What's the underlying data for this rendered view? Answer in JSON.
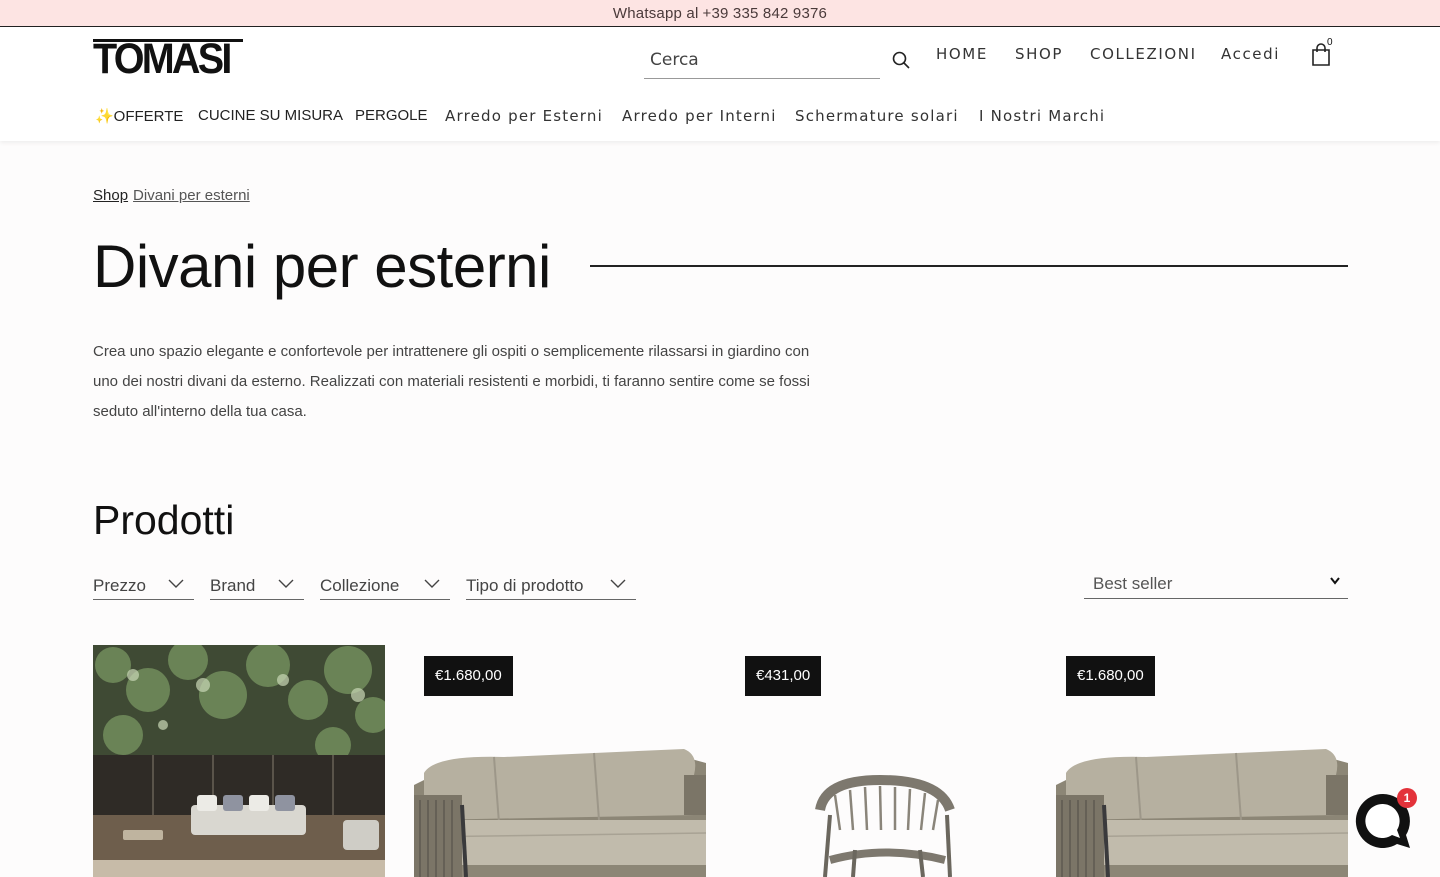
{
  "announcement": {
    "prefix": "Whatsapp al ",
    "phone": "+39 335 842 9376"
  },
  "header": {
    "logo": "TOMASI",
    "search_placeholder": "Cerca",
    "nav": [
      "HOME",
      "SHOP",
      "COLLEZIONI",
      "Accedi"
    ],
    "cart_count": "0"
  },
  "categories": [
    "✨OFFERTE",
    "CUCINE SU MISURA",
    "PERGOLE",
    "Arredo per Esterni",
    "Arredo per Interni",
    "Schermature solari",
    "I Nostri Marchi"
  ],
  "breadcrumb": {
    "shop": "Shop",
    "current": "Divani per esterni"
  },
  "page": {
    "title": "Divani per esterni",
    "intro": "Crea uno spazio elegante e confortevole per intrattenere gli ospiti o semplicemente rilassarsi in giardino con uno dei nostri divani da esterno. Realizzati con materiali resistenti e morbidi, ti faranno sentire come se fossi seduto all'interno della tua casa."
  },
  "products": {
    "section_title": "Prodotti",
    "filters": [
      "Prezzo",
      "Brand",
      "Collezione",
      "Tipo di prodotto"
    ],
    "sort_selected": "Best seller",
    "cards": [
      {
        "price": "€1.680,00"
      },
      {
        "price": "€431,00"
      },
      {
        "price": "€1.680,00"
      }
    ]
  },
  "chat": {
    "badge": "1"
  },
  "colors": {
    "announcement_bg": "#fde4e3",
    "price_badge": "#111111",
    "chat_badge": "#e3323a"
  }
}
